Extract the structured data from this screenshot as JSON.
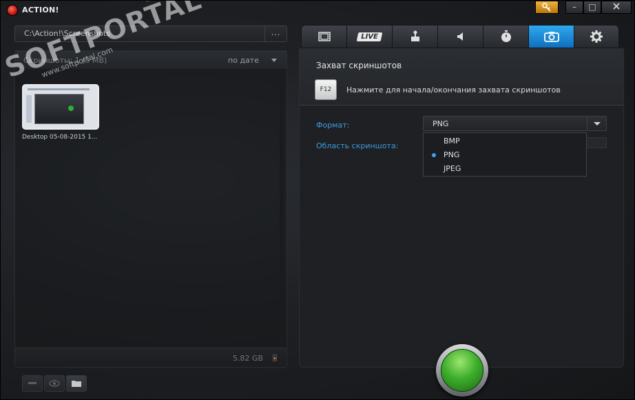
{
  "app": {
    "title": "ACTION!"
  },
  "window_controls": {
    "minimize": "–",
    "maximize": "□"
  },
  "path": {
    "value": "C:\\Action!\\Screenshots",
    "browse_label": "..."
  },
  "list": {
    "title": "Скриншоты: 1 (0 MB)",
    "sort_label": "по дате",
    "items": [
      {
        "caption": "Desktop 05-08-2015 1..."
      }
    ],
    "free_space": "5.82 GB"
  },
  "tabs": [
    {
      "name": "video",
      "icon": "film-icon"
    },
    {
      "name": "live",
      "label": "LIVE"
    },
    {
      "name": "gameplay",
      "icon": "joystick-icon"
    },
    {
      "name": "audio",
      "icon": "speaker-icon"
    },
    {
      "name": "benchmark",
      "icon": "stopwatch-icon"
    },
    {
      "name": "screenshots",
      "icon": "camera-icon",
      "active": true
    },
    {
      "name": "settings",
      "icon": "gear-icon"
    }
  ],
  "screenshot_settings": {
    "section_title": "Захват скриншотов",
    "hotkey_key": "F12",
    "hotkey_hint": "Нажмите для начала/окончания захвата скриншотов",
    "format_label": "Формат:",
    "format_value": "PNG",
    "area_label": "Область скриншота:",
    "format_options": [
      "BMP",
      "PNG",
      "JPEG"
    ],
    "selected_option": "PNG"
  },
  "watermark": {
    "text": "SOFTPORTAL",
    "url": "www.softportal.com",
    "tm": "TM"
  },
  "colors": {
    "accent": "#1e8fdc",
    "record": "#3fae2c",
    "label": "#3e9bde"
  }
}
